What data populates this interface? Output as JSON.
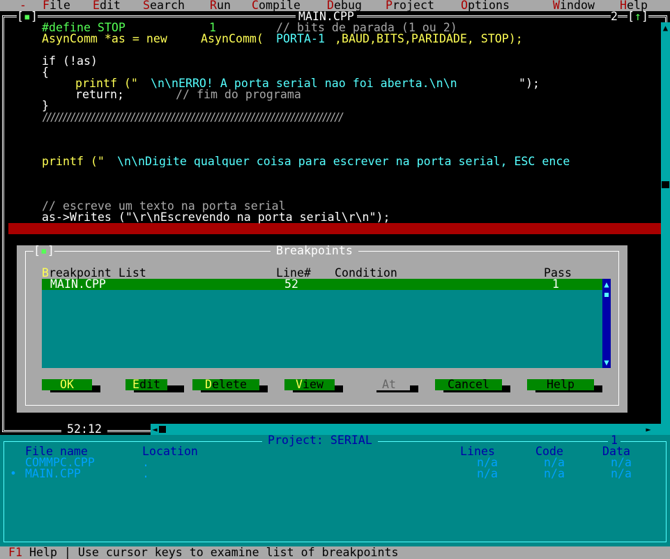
{
  "menu": {
    "system": "-",
    "items": [
      {
        "hot": "F",
        "rest": "ile"
      },
      {
        "hot": "E",
        "rest": "dit"
      },
      {
        "hot": "S",
        "rest": "earch"
      },
      {
        "hot": "R",
        "rest": "un"
      },
      {
        "hot": "C",
        "rest": "ompile"
      },
      {
        "hot": "D",
        "rest": "ebug"
      },
      {
        "hot": "P",
        "rest": "roject"
      },
      {
        "hot": "O",
        "rest": "ptions"
      },
      {
        "hot": "W",
        "rest": "indow"
      },
      {
        "hot": "H",
        "rest": "elp"
      }
    ]
  },
  "editor": {
    "close_box": "[▪]",
    "title": "MAIN.CPP",
    "window_number": "2",
    "zoom_box": "[↑]",
    "cursor_pos": "52:12",
    "lines": {
      "l1_a": "#define STOP",
      "l1_b": "1",
      "l1_c": "// bits de parada (1 ou 2)",
      "l2_a": "AsynComm *as = new ",
      "l2_b": "AsynComm(",
      "l2_c": "PORTA-1",
      "l2_d": ",BAUD,BITS,PARIDADE, STOP);",
      "l3": "if (!as)",
      "l4": "{",
      "l5_a": "printf (\"",
      "l5_b": "\\n\\nERRO! A porta serial nao foi aberta.\\n\\n",
      "l5_c": "\");",
      "l6_a": "return;",
      "l6_b": "// fim do programa",
      "l7": "}",
      "l8": "///////////////////////////////////////////////////////////////////////////",
      "l9_a": "printf (\"",
      "l9_b": "\\n\\nDigite qualquer coisa para escrever na porta serial, ESC ence",
      "l10": "// escreve um texto na porta serial",
      "l11": "as->Writes (\"\\r\\nEscrevendo na porta serial\\r\\n\");"
    }
  },
  "breakpoints": {
    "close_box": "[▪]",
    "title": "Breakpoints",
    "list_label_hot": "B",
    "list_label_rest": "reakpoint List",
    "col_line": "Line#",
    "col_condition": "Condition",
    "col_pass": "Pass",
    "rows": [
      {
        "file": "MAIN.CPP",
        "line": "52",
        "condition": "",
        "pass": "1"
      }
    ],
    "buttons": {
      "ok": "OK",
      "edit_hot": "E",
      "edit_rest": "dit",
      "delete_hot": "D",
      "delete_rest": "elete",
      "view_hot": "V",
      "view_rest": "iew",
      "at": "At",
      "cancel": "Cancel",
      "help": "Help"
    }
  },
  "project": {
    "title": "Project: SERIAL",
    "window_number": "1",
    "col_file": "File name",
    "col_location": "Location",
    "col_lines": "Lines",
    "col_code": "Code",
    "col_data": "Data",
    "rows": [
      {
        "marker": "",
        "file": "COMMPC.CPP",
        "location": ".",
        "lines": "n/a",
        "code": "n/a",
        "data": "n/a"
      },
      {
        "marker": "•",
        "file": "MAIN.CPP",
        "location": ".",
        "lines": "n/a",
        "code": "n/a",
        "data": "n/a"
      }
    ]
  },
  "status": {
    "key": "F1",
    "text": " Help | Use cursor keys to examine list of breakpoints"
  }
}
